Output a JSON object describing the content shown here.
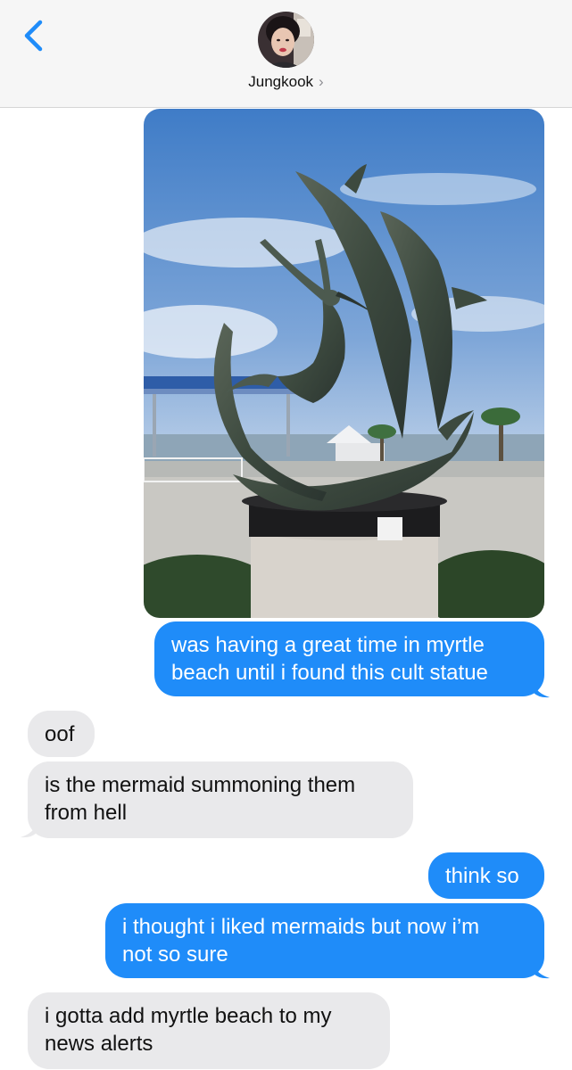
{
  "header": {
    "contact_name": "Jungkook",
    "chevron": "›",
    "back_icon": "chevron-left-icon",
    "accent_color": "#1f8cf9"
  },
  "messages": [
    {
      "from": "me",
      "type": "image",
      "description_icon": "photo-attachment"
    },
    {
      "from": "me",
      "text_lines": [
        "was having a great time in myrtle",
        "beach until i found this cult statue"
      ]
    },
    {
      "from": "them",
      "text_lines": [
        "oof"
      ]
    },
    {
      "from": "them",
      "text_lines": [
        "is the mermaid summoning them",
        "from hell"
      ]
    },
    {
      "from": "me",
      "text_lines": [
        "think so"
      ]
    },
    {
      "from": "me",
      "text_lines": [
        "i thought i liked mermaids but now i’m",
        "not so sure"
      ]
    },
    {
      "from": "them",
      "text_lines": [
        "i gotta add myrtle beach to my",
        "news alerts"
      ]
    }
  ],
  "colors": {
    "outgoing_bubble": "#1f8cf9",
    "incoming_bubble": "#e9e9eb"
  }
}
